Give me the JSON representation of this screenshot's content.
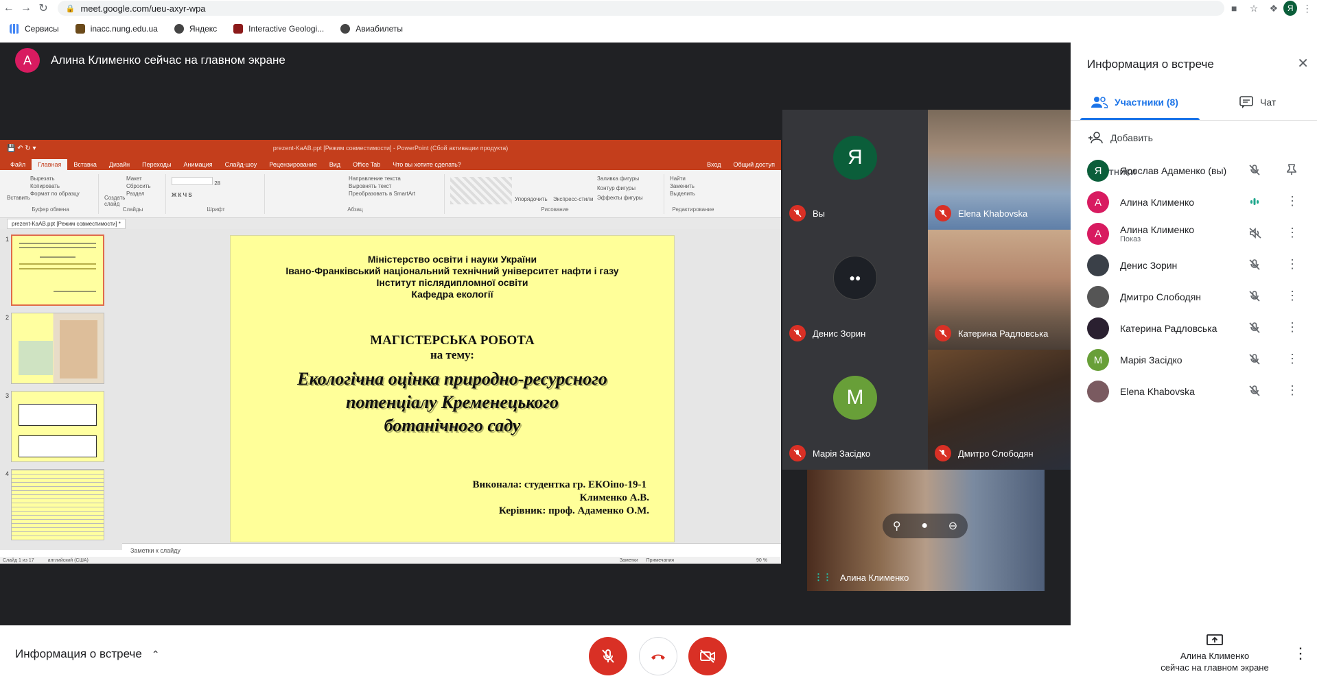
{
  "browser": {
    "url": "meet.google.com/ueu-axyr-wpa",
    "profile_initial": "Я",
    "bookmarks": [
      {
        "label": "Сервисы",
        "icon": "apps-grid-icon"
      },
      {
        "label": "inacc.nung.edu.ua",
        "icon": "crest-icon"
      },
      {
        "label": "Яндекс",
        "icon": "globe-icon"
      },
      {
        "label": "Interactive Geologi...",
        "icon": "site-icon"
      },
      {
        "label": "Авиабилеты",
        "icon": "globe-icon"
      }
    ]
  },
  "presenter_banner": {
    "initial": "А",
    "text": "Алина Клименко сейчас на главном экране",
    "color": "#d81b60"
  },
  "ppt": {
    "title": "prezent-KaAB.ppt [Режим совместимости] - PowerPoint (Сбой активации продукта)",
    "tabs": [
      "Файл",
      "Главная",
      "Вставка",
      "Дизайн",
      "Переходы",
      "Анимация",
      "Слайд-шоу",
      "Рецензирование",
      "Вид",
      "Office Tab",
      "Что вы хотите сделать?"
    ],
    "right_tabs": [
      "Вход",
      "Общий доступ"
    ],
    "ribbon": {
      "paste": "Вставить",
      "cut": "Вырезать",
      "copy": "Копировать",
      "format_painter": "Формат по образцу",
      "clipboard": "Буфер обмена",
      "create_slide": "Создать слайд",
      "layout": "Макет",
      "reset": "Сбросить",
      "section": "Раздел",
      "slides": "Слайды",
      "font_group": "Шрифт",
      "paragraph_group": "Абзац",
      "text_direction": "Направление текста",
      "align_text": "Выровнять текст",
      "smartart": "Преобразовать в SmartArt",
      "arrange": "Упорядочить",
      "express_styles": "Экспресс-стили",
      "fill": "Заливка фигуры",
      "outline": "Контур фигуры",
      "effects": "Эффекты фигуры",
      "drawing": "Рисование",
      "find": "Найти",
      "replace": "Заменить",
      "select": "Выделить",
      "editing": "Редактирование",
      "font_size": "28"
    },
    "doc_tab": "prezent-KaAB.ppt [Режим совместимости] *",
    "thumbnails": [
      "1",
      "2",
      "3",
      "4"
    ],
    "slide": {
      "head": [
        "Міністерство освіти і науки України",
        "Івано-Франківський національний технічний університет нафти і газу",
        "Інститут післядипломної освіти",
        "Кафедра екології"
      ],
      "title1": "МАГІСТЕРСЬКА РОБОТА",
      "title2": "на тему:",
      "topic": [
        "Екологічна оцінка природно-ресурсного",
        "потенціалу Кременецького",
        "ботанічного саду"
      ],
      "author1": "Виконала: студентка гр. ЕКОіпо-19-1",
      "author2": "Клименко А.В.",
      "supervisor": "Керівник: проф. Адаменко О.М."
    },
    "notes_placeholder": "Заметки к слайду",
    "status_left": "Слайд 1 из 17",
    "status_lang": "английский (США)",
    "status_notes": "Заметки",
    "status_comments": "Примечания",
    "zoom": "90 %"
  },
  "tiles": [
    {
      "name": "Вы",
      "initial": "Я",
      "color": "#0b5e3a",
      "mic": "off"
    },
    {
      "name": "Elena Khabovska",
      "mic": "off"
    },
    {
      "name": "Денис Зорин",
      "mic": "off"
    },
    {
      "name": "Катерина Радловська",
      "mic": "off"
    },
    {
      "name": "Марія Засідко",
      "initial": "M",
      "color": "#689f38",
      "mic": "off"
    },
    {
      "name": "Дмитро Слободян",
      "mic": "off"
    },
    {
      "name": "Алина Клименко",
      "mic": "speaking"
    }
  ],
  "side_panel": {
    "title": "Информация о встрече",
    "tab_people": "Участники (8)",
    "tab_chat": "Чат",
    "add": "Добавить",
    "section": "УЧАСТНИКИ",
    "participants": [
      {
        "name": "Ярослав Адаменко (вы)",
        "initial": "Я",
        "color": "#0b5e3a",
        "mic": "off",
        "action": "pin"
      },
      {
        "name": "Алина Клименко",
        "initial": "А",
        "color": "#d81b60",
        "mic": "speaking",
        "action": "more"
      },
      {
        "name": "Алина Клименко",
        "sub": "Показ",
        "initial": "А",
        "color": "#d81b60",
        "mic": "muted-screen",
        "action": "more"
      },
      {
        "name": "Денис Зорин",
        "initial": "",
        "color": "#3a4048",
        "mic": "off",
        "action": "more"
      },
      {
        "name": "Дмитро Слободян",
        "initial": "",
        "color": "#555555",
        "mic": "off",
        "action": "more"
      },
      {
        "name": "Катерина Радловська",
        "initial": "",
        "color": "#2a2030",
        "mic": "off",
        "action": "more"
      },
      {
        "name": "Марія Засідко",
        "initial": "M",
        "color": "#689f38",
        "mic": "off",
        "action": "more"
      },
      {
        "name": "Elena Khabovska",
        "initial": "",
        "color": "#7a5a60",
        "mic": "off",
        "action": "more"
      }
    ]
  },
  "bottom": {
    "meeting_info": "Информация о встрече",
    "presenting_line1": "Алина Клименко",
    "presenting_line2": "сейчас на главном экране"
  }
}
